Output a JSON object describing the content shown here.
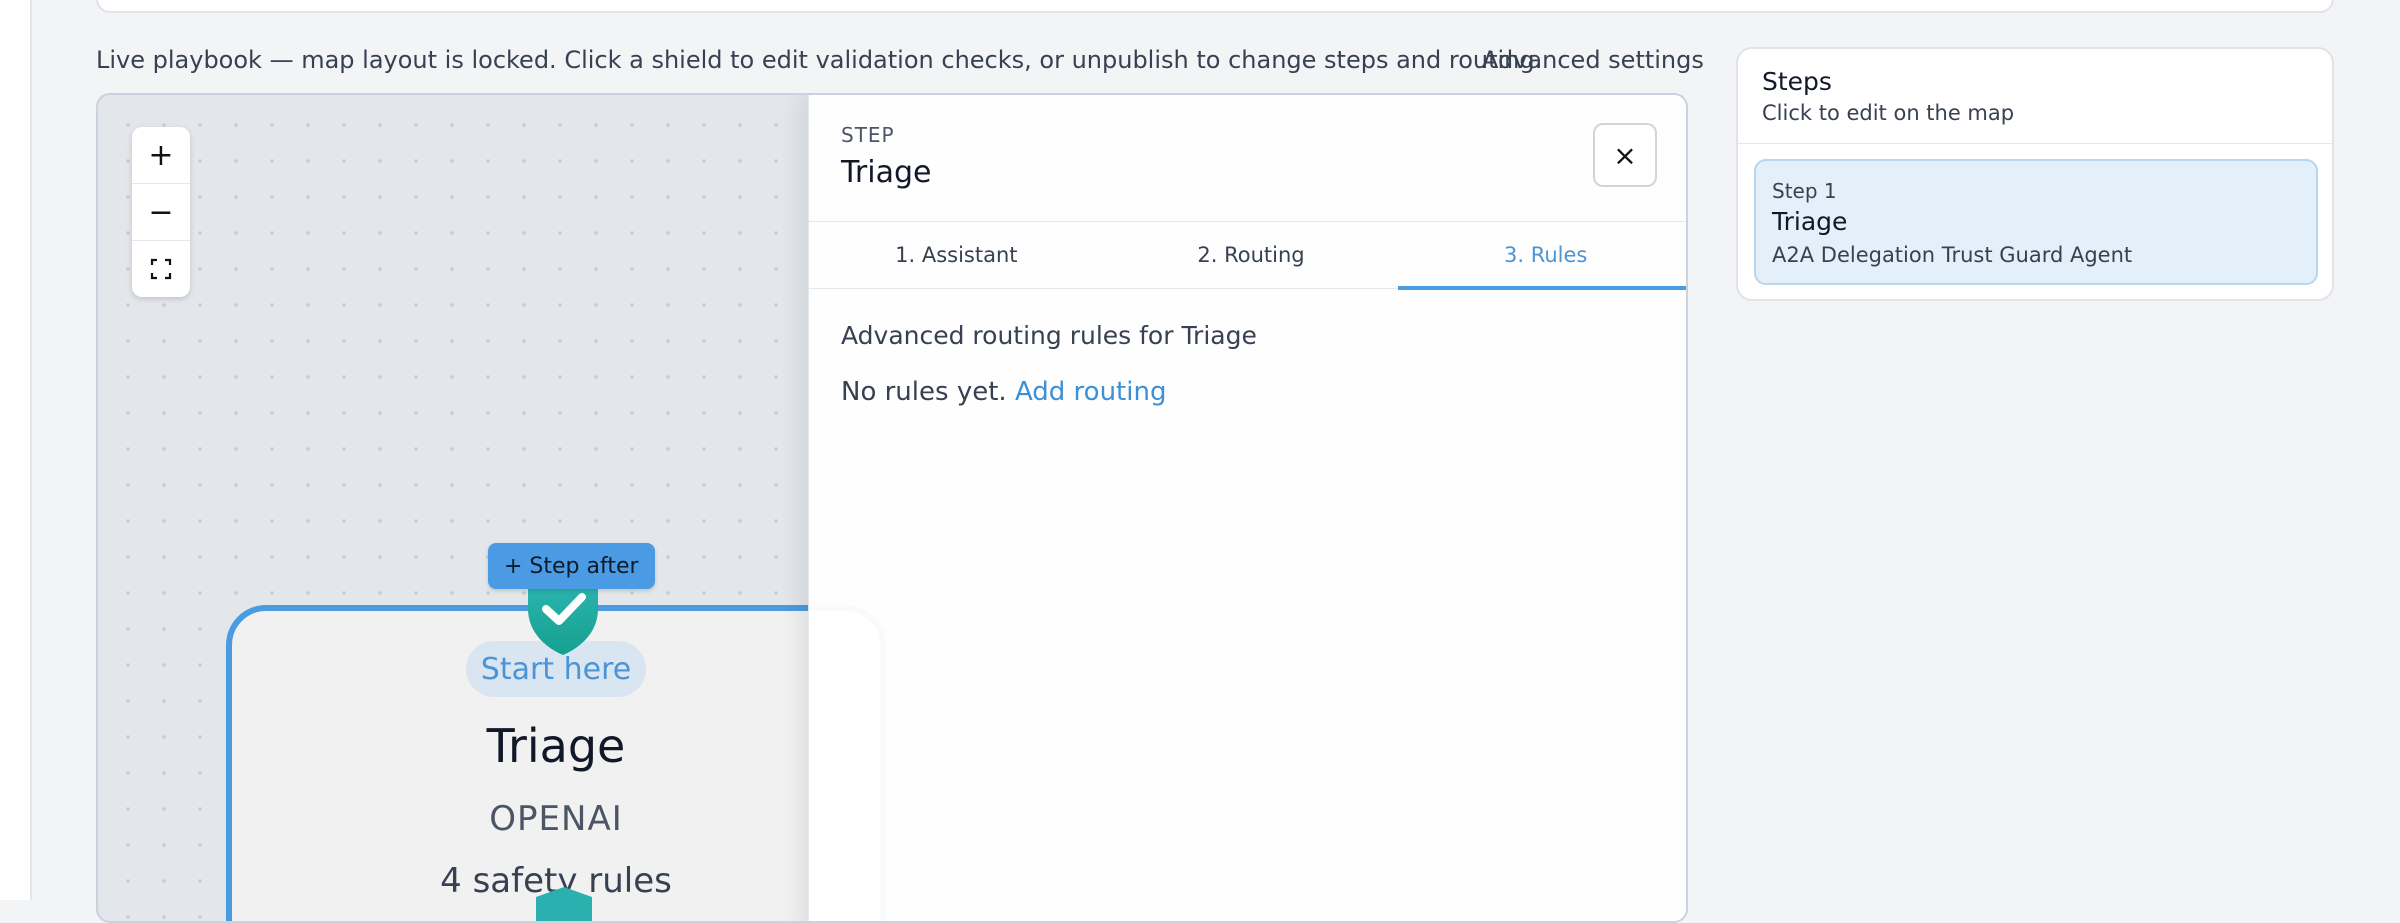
{
  "header": {
    "locked_message": "Live playbook — map layout is locked. Click a shield to edit validation checks, or unpublish to change steps and routing.",
    "advanced_settings": "Advanced settings"
  },
  "map": {
    "zoom_in": "+",
    "zoom_out": "−",
    "fit_view": "⛶",
    "step_after_button": "+ Step after",
    "node": {
      "badge": "Start here",
      "title": "Triage",
      "provider": "OPENAI",
      "rules": "4 safety rules"
    }
  },
  "drawer": {
    "kicker": "STEP",
    "title": "Triage",
    "close": "×",
    "tabs": [
      {
        "label": "1. Assistant",
        "active": false
      },
      {
        "label": "2. Routing",
        "active": false
      },
      {
        "label": "3. Rules",
        "active": true
      }
    ],
    "heading": "Advanced routing rules for Triage",
    "empty_text": "No rules yet.",
    "add_link": "Add routing"
  },
  "steps_panel": {
    "title": "Steps",
    "subtitle": "Click to edit on the map",
    "items": [
      {
        "number": "Step 1",
        "name": "Triage",
        "agent": "A2A Delegation Trust Guard Agent"
      }
    ]
  },
  "colors": {
    "accent": "#4b9be0",
    "shield_top": "#2bb3b1",
    "shield_bottom": "#16a08f"
  }
}
